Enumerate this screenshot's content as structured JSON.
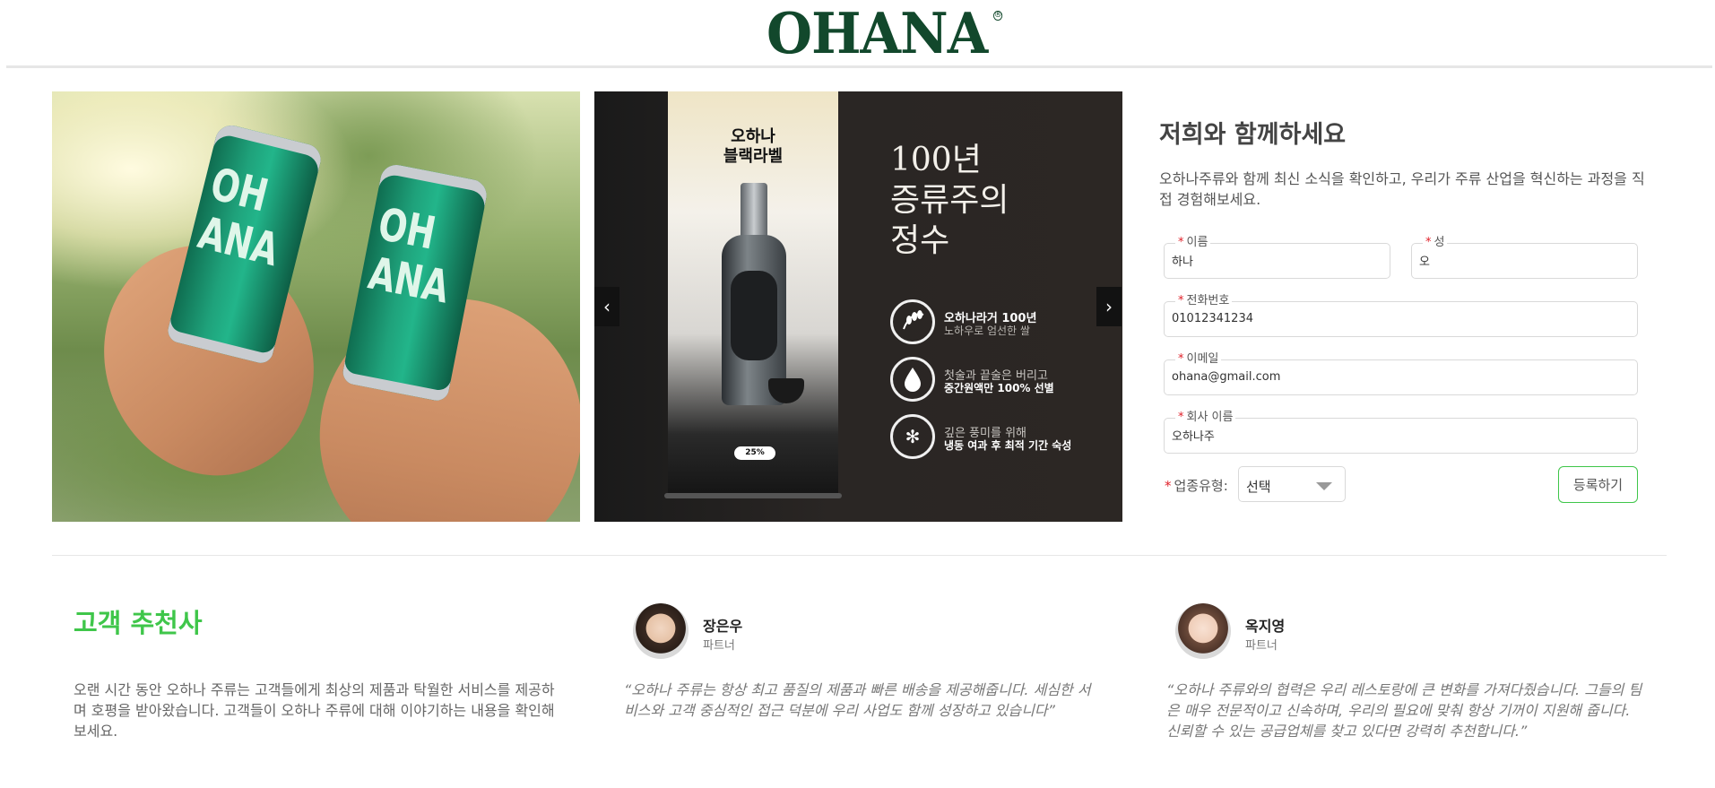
{
  "header": {
    "logo_text": "OHANA",
    "logo_mark": "®"
  },
  "hero": {
    "left_image": {
      "can_text_1": "OH\nANA",
      "can_text_2": "OH\nANA"
    },
    "slider": {
      "poster_title": "오하나\n블랙라벨",
      "percent_badge": "25%",
      "headline": "100년\n증류주의\n정수",
      "features": [
        {
          "icon": "rice-icon",
          "line1": "오하나라거 100년",
          "line2": "노하우로 엄선한 쌀"
        },
        {
          "icon": "droplet-icon",
          "line1": "첫술과 끝술은 버리고",
          "line2": "중간원액만 100% 선별"
        },
        {
          "icon": "snowflake-icon",
          "line1": "깊은 풍미를 위해",
          "line2": "냉동 여과 후 최적 기간 숙성"
        }
      ],
      "prev_symbol": "‹",
      "next_symbol": "›"
    }
  },
  "form": {
    "title": "저희와 함께하세요",
    "description": "오하나주류와 함께 최신 소식을 확인하고, 우리가 주류 산업을 혁신하는 과정을 직접 경험해보세요.",
    "required_mark": "*",
    "first_name": {
      "label": "이름",
      "value": "하나"
    },
    "last_name": {
      "label": "성",
      "value": "오"
    },
    "phone": {
      "label": "전화번호",
      "value": "01012341234"
    },
    "email": {
      "label": "이메일",
      "value": "ohana@gmail.com"
    },
    "company": {
      "label": "회사 이름",
      "value": "오하나주"
    },
    "business_type": {
      "label": "업종유형:",
      "selected": "선택"
    },
    "submit_label": "등록하기"
  },
  "testimonials": {
    "heading": "고객 추천사",
    "intro": "오랜 시간 동안 오하나 주류는 고객들에게 최상의 제품과 탁월한 서비스를 제공하며 호평을 받아왔습니다. 고객들이 오하나 주류에 대해 이야기하는 내용을 확인해 보세요.",
    "items": [
      {
        "name": "장은우",
        "role": "파트너",
        "quote": "“오하나 주류는 항상 최고 품질의 제품과 빠른 배송을 제공해줍니다. 세심한 서비스와 고객 중심적인 접근 덕분에 우리 사업도 함께 성장하고 있습니다”"
      },
      {
        "name": "옥지영",
        "role": "파트너",
        "quote": "“오하나 주류와의 협력은 우리 레스토랑에 큰 변화를 가져다줬습니다. 그들의 팀은 매우 전문적이고 신속하며, 우리의 필요에 맞춰 항상 기꺼이 지원해 줍니다. 신뢰할 수 있는 공급업체를 찾고 있다면 강력히 추천합니다.”"
      }
    ]
  },
  "colors": {
    "brand_green": "#12482c",
    "accent_green": "#3fc64a",
    "required_red": "#e0212a"
  }
}
